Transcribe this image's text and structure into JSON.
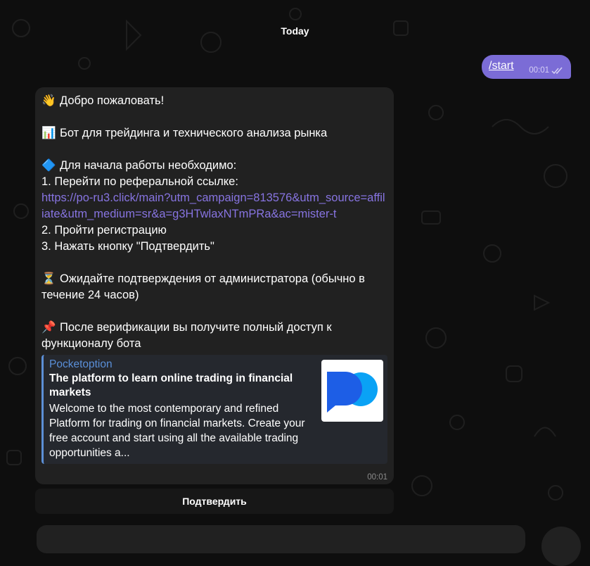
{
  "chat": {
    "date_separator": "Today",
    "outgoing": {
      "text": "/start",
      "time": "00:01",
      "status_icon": "double-check-icon"
    },
    "incoming": {
      "lines": [
        {
          "emoji": "👋",
          "text": "Добро пожаловать!"
        },
        {
          "emoji": "📊",
          "text": "Бот для трейдинга и технического анализа рынка"
        },
        {
          "emoji": "🔷",
          "text": "Для начала работы необходимо:"
        },
        {
          "text": "1. Перейти по реферальной ссылке:"
        },
        {
          "link": "https://po-ru3.click/main?utm_campaign=813576&utm_source=affiliate&utm_medium=sr&a=g3HTwlaxNTmPRa&ac=mister-t"
        },
        {
          "text": "2. Пройти регистрацию"
        },
        {
          "text": "3. Нажать кнопку \"Подтвердить\""
        },
        {
          "emoji": "⏳",
          "text": "Ожидайте подтверждения от администратора (обычно в течение 24 часов)"
        },
        {
          "emoji": "📌",
          "text": "После верификации вы получите полный доступ к функционалу бота"
        }
      ],
      "time": "00:01",
      "link_preview": {
        "site_name": "Pocketoption",
        "title": "The platform to learn online trading in financial markets",
        "description": "Welcome to the most contemporary and refined Platform for trading on financial markets. Create your free account and start using all the available trading opportunities a...",
        "thumbnail_icon": "pocketoption-logo-icon"
      }
    },
    "inline_button": {
      "label": "Подтвердить"
    }
  },
  "colors": {
    "background": "#0e0e0e",
    "outgoing_bubble": "#7b6cd6",
    "incoming_bubble": "#212121",
    "link": "#8774e1",
    "preview_accent": "#5a8fd8",
    "logo_blue": "#1d5ee6",
    "logo_cyan": "#0aa2f5"
  }
}
